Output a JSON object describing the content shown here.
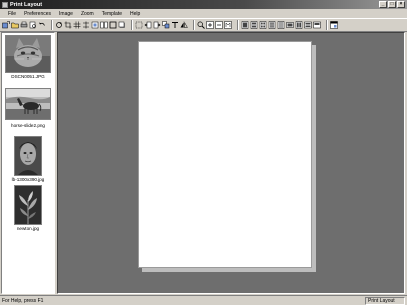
{
  "window": {
    "title": "Print Layout"
  },
  "menubar": {
    "items": [
      {
        "label": "File"
      },
      {
        "label": "Preferences"
      },
      {
        "label": "Image"
      },
      {
        "label": "Zoom"
      },
      {
        "label": "Template"
      },
      {
        "label": "Help"
      }
    ]
  },
  "thumbnails": [
    {
      "label": "DSCN0051.JPG",
      "subject": "cat",
      "selected": true
    },
    {
      "label": "horse-slide2.png",
      "subject": "horse",
      "selected": false
    },
    {
      "label": "lb-1300x390.jpg",
      "subject": "portrait",
      "selected": false
    },
    {
      "label": "newton.jpg",
      "subject": "plant",
      "selected": false
    }
  ],
  "status": {
    "help_text": "For Help, press F1",
    "mode": "Print Layout"
  }
}
